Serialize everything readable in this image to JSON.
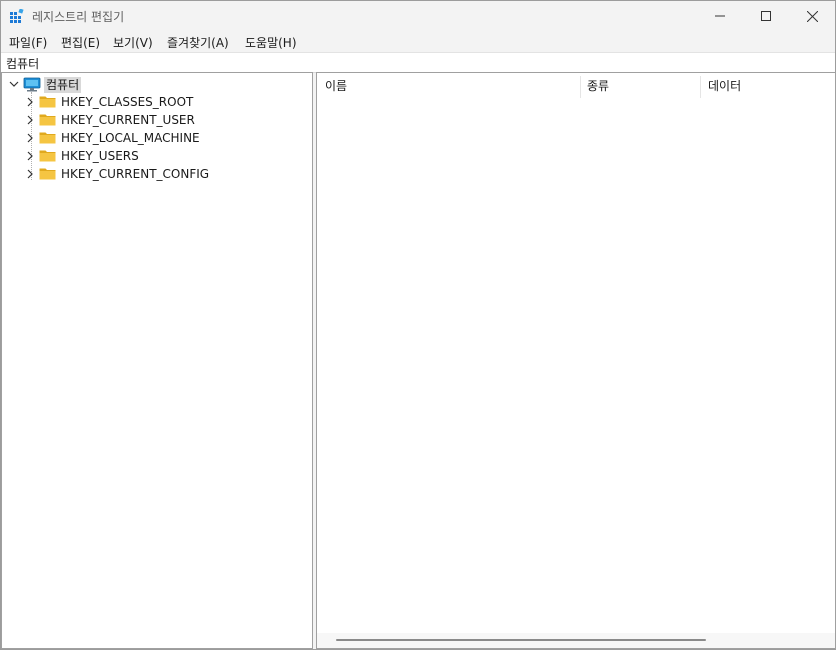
{
  "window": {
    "title": "레지스트리 편집기",
    "icon": "registry-editor-icon"
  },
  "caption_buttons": {
    "minimize": "minimize-icon",
    "maximize": "maximize-icon",
    "close": "close-icon"
  },
  "menu": [
    {
      "label": "파일(F)"
    },
    {
      "label": "편집(E)"
    },
    {
      "label": "보기(V)"
    },
    {
      "label": "즐겨찾기(A)"
    },
    {
      "label": "도움말(H)"
    }
  ],
  "address": {
    "path": "컴퓨터"
  },
  "tree": {
    "root": {
      "label": "컴퓨터",
      "icon": "computer-icon",
      "expanded": true
    },
    "items": [
      {
        "label": "HKEY_CLASSES_ROOT",
        "icon": "folder-icon"
      },
      {
        "label": "HKEY_CURRENT_USER",
        "icon": "folder-icon"
      },
      {
        "label": "HKEY_LOCAL_MACHINE",
        "icon": "folder-icon"
      },
      {
        "label": "HKEY_USERS",
        "icon": "folder-icon"
      },
      {
        "label": "HKEY_CURRENT_CONFIG",
        "icon": "folder-icon"
      }
    ]
  },
  "list": {
    "columns": [
      {
        "label": "이름"
      },
      {
        "label": "종류"
      },
      {
        "label": "데이터"
      }
    ]
  },
  "colors": {
    "folder": "#f5c542",
    "folder_dark": "#e0a91e",
    "monitor": "#1e8fd6",
    "selection": "#d9d9d9"
  }
}
